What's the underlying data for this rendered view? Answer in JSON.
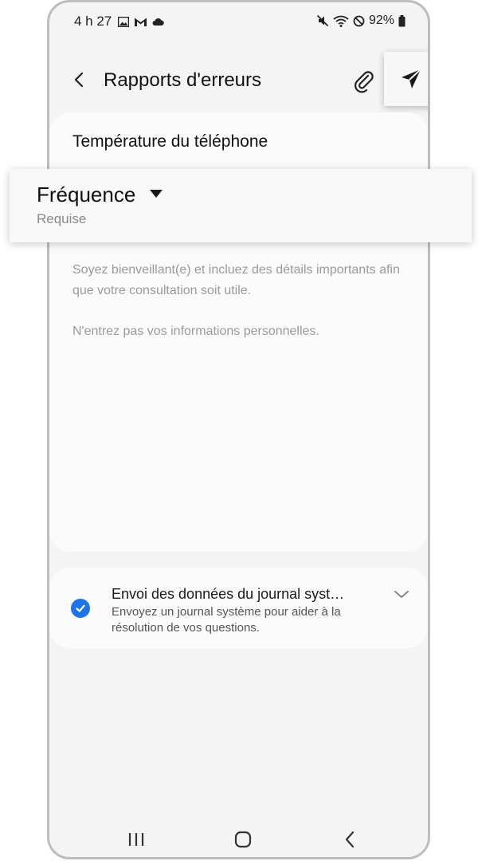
{
  "status_bar": {
    "time": "4 h 27",
    "battery": "92%",
    "left_icons": [
      "gallery-icon",
      "gmail-icon",
      "cloud-icon"
    ],
    "right_icons": [
      "mute-icon",
      "wifi-icon",
      "dnd-icon",
      "battery-icon"
    ]
  },
  "app_bar": {
    "title": "Rapports d'erreurs",
    "back_icon": "back-arrow-icon",
    "attach_icon": "paperclip-icon",
    "send_icon": "send-icon"
  },
  "form": {
    "subject": "Température du téléphone",
    "frequency_label": "Fréquence",
    "frequency_required": "Requise",
    "hint_line1": "Soyez bienveillant(e) et incluez des détails importants afin que votre consultation soit utile.",
    "hint_line2": "N'entrez pas vos informations personnelles."
  },
  "system_log": {
    "checked": true,
    "title": "Envoi des données du journal syst…",
    "subtitle": "Envoyez un journal système pour aider à la résolution de vos questions."
  },
  "nav_bar": {
    "items": [
      "recent-apps-icon",
      "home-icon",
      "back-icon"
    ]
  },
  "colors": {
    "accent": "#1e74e8",
    "background": "#f4f4f4",
    "card": "#fbfbfb"
  }
}
